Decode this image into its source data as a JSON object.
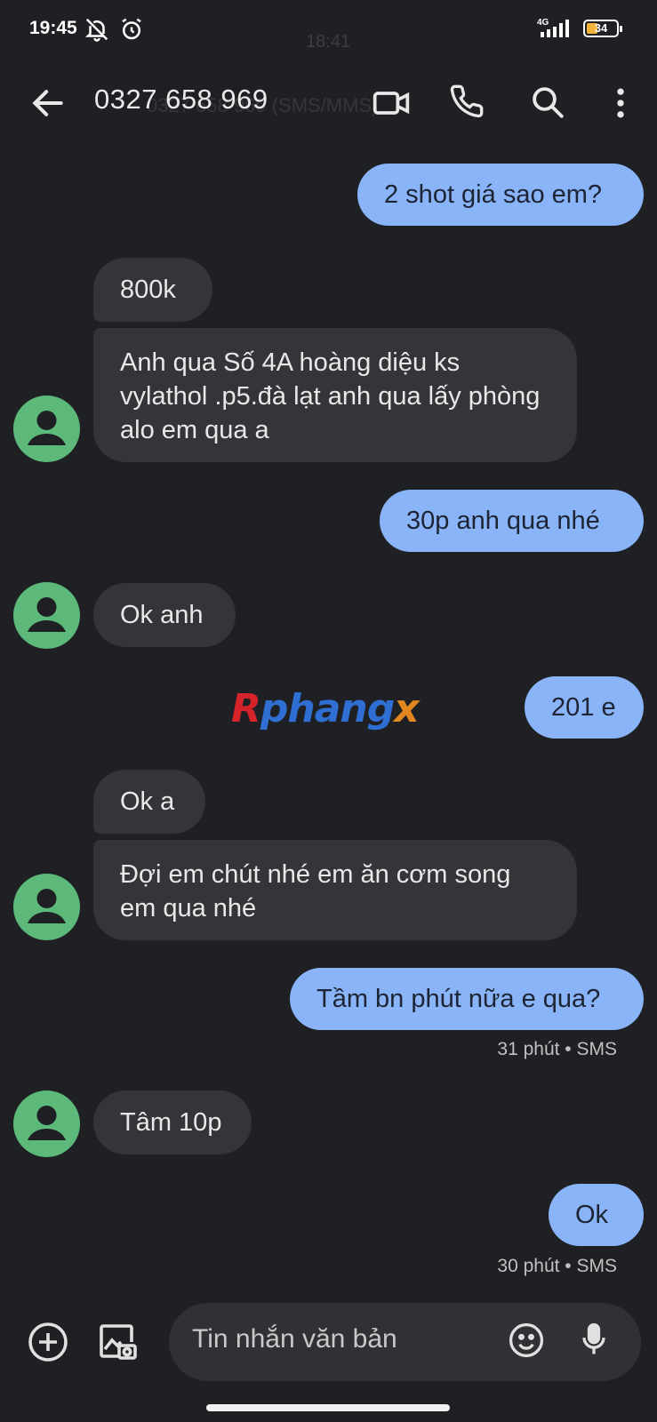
{
  "status_bar": {
    "time": "19:45",
    "ghost_time": "18:41",
    "network": "4G",
    "battery": "34"
  },
  "app_bar": {
    "title": "0327 658 969",
    "ghost_subtitle": "0327 658 969 (SMS/MMS)"
  },
  "messages": [
    {
      "type": "out",
      "text": "2 shot giá sao em?"
    },
    {
      "type": "in",
      "text": "800k"
    },
    {
      "type": "in",
      "text": "Anh qua Số 4A hoàng diệu ks vylathol .p5.đà lạt anh qua lấy phòng alo em qua a"
    },
    {
      "type": "out",
      "text": "30p anh qua nhé"
    },
    {
      "type": "in",
      "text": "Ok anh"
    },
    {
      "type": "out",
      "text": "201 e"
    },
    {
      "type": "in",
      "text": "Ok a"
    },
    {
      "type": "in",
      "text": "Đợi em chút nhé em ăn cơm song em qua nhé"
    },
    {
      "type": "out",
      "text": "Tầm bn phút nữa e qua?",
      "meta": "31 phút • SMS"
    },
    {
      "type": "in",
      "text": "Tâm 10p"
    },
    {
      "type": "out",
      "text": "Ok",
      "meta": "30 phút • SMS"
    }
  ],
  "watermark": {
    "part1": "R",
    "part2": "phang",
    "part3": "x"
  },
  "composer": {
    "placeholder": "Tin nhắn văn bản"
  },
  "icons": {
    "back": "arrow-back-icon",
    "video": "video-call-icon",
    "phone": "phone-icon",
    "search": "search-icon",
    "more": "more-vert-icon",
    "add": "add-circle-icon",
    "gallery": "gallery-camera-icon",
    "emoji": "emoji-icon",
    "mic": "mic-icon"
  },
  "colors": {
    "background": "#1f2023",
    "outgoing_bubble": "#8ab4f8",
    "incoming_bubble": "#333538",
    "avatar": "#5cb97a"
  }
}
